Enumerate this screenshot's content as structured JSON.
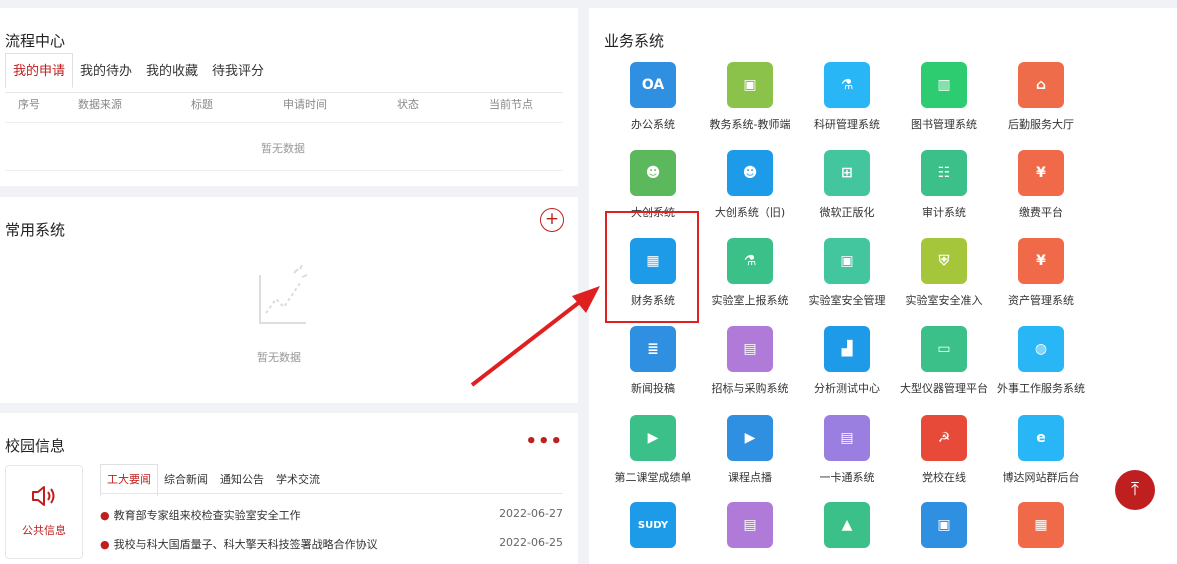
{
  "flow": {
    "title": "流程中心",
    "tabs": [
      "我的申请",
      "我的待办",
      "我的收藏",
      "待我评分"
    ],
    "columns": [
      "序号",
      "数据来源",
      "标题",
      "申请时间",
      "状态",
      "当前节点"
    ],
    "empty_text": "暂无数据"
  },
  "common": {
    "title": "常用系统",
    "add_label": "+",
    "empty_text": "暂无数据"
  },
  "campus": {
    "title": "校园信息",
    "more_label": "•••",
    "notice_label": "公共信息",
    "news_tabs": [
      "工大要闻",
      "综合新闻",
      "通知公告",
      "学术交流"
    ],
    "news": [
      {
        "title": "教育部专家组来校检查实验室安全工作",
        "date": "2022-06-27"
      },
      {
        "title": "我校与科大国盾量子、科大擎天科技签署战略合作协议",
        "date": "2022-06-25"
      }
    ]
  },
  "biz": {
    "title": "业务系统",
    "items": [
      {
        "label": "办公系统",
        "icon": "oa-icon",
        "color": "#2f8fe0",
        "glyph": "OA"
      },
      {
        "label": "教务系统-教师端",
        "icon": "teacher-screen-icon",
        "color": "#8bc34a",
        "glyph": "▣"
      },
      {
        "label": "科研管理系统",
        "icon": "microscope-icon",
        "color": "#29b6f6",
        "glyph": "⚗"
      },
      {
        "label": "图书管理系统",
        "icon": "books-icon",
        "color": "#2ecc71",
        "glyph": "▥"
      },
      {
        "label": "后勤服务大厅",
        "icon": "house-user-icon",
        "color": "#ef6c4a",
        "glyph": "⌂"
      },
      {
        "label": "大创系统",
        "icon": "graduates-icon",
        "color": "#5cb85c",
        "glyph": "☻"
      },
      {
        "label": "大创系统（旧)",
        "icon": "graduates-old-icon",
        "color": "#1e9be8",
        "glyph": "☻"
      },
      {
        "label": "微软正版化",
        "icon": "windows-icon",
        "color": "#43c59e",
        "glyph": "⊞"
      },
      {
        "label": "审计系统",
        "icon": "clipboard-icon",
        "color": "#3cc08a",
        "glyph": "☷"
      },
      {
        "label": "缴费平台",
        "icon": "payment-icon",
        "color": "#f06a4a",
        "glyph": "¥"
      },
      {
        "label": "财务系统",
        "icon": "finance-monitor-icon",
        "color": "#1e9be8",
        "glyph": "▦"
      },
      {
        "label": "实验室上报系统",
        "icon": "lab-report-icon",
        "color": "#3cc08a",
        "glyph": "⚗"
      },
      {
        "label": "实验室安全管理",
        "icon": "lab-safety-monitor-icon",
        "color": "#43c59e",
        "glyph": "▣"
      },
      {
        "label": "实验室安全准入",
        "icon": "shield-icon",
        "color": "#a5c63b",
        "glyph": "⛨"
      },
      {
        "label": "资产管理系统",
        "icon": "asset-house-icon",
        "color": "#f06a4a",
        "glyph": "¥"
      },
      {
        "label": "新闻投稿",
        "icon": "news-icon",
        "color": "#2f8fe0",
        "glyph": "≣"
      },
      {
        "label": "招标与采购系统",
        "icon": "cart-icon",
        "color": "#b07ad8",
        "glyph": "▤"
      },
      {
        "label": "分析测试中心",
        "icon": "bar-chart-icon",
        "color": "#1e9be8",
        "glyph": "▟"
      },
      {
        "label": "大型仪器管理平台",
        "icon": "instrument-monitor-icon",
        "color": "#3cc08a",
        "glyph": "▭"
      },
      {
        "label": "外事工作服务系统",
        "icon": "globe-monitor-icon",
        "color": "#29b6f6",
        "glyph": "◍"
      },
      {
        "label": "第二课堂成绩单",
        "icon": "play-hexagon-icon",
        "color": "#3cc08a",
        "glyph": "▶"
      },
      {
        "label": "课程点播",
        "icon": "video-icon",
        "color": "#2f8fe0",
        "glyph": "▶"
      },
      {
        "label": "一卡通系统",
        "icon": "id-card-icon",
        "color": "#9b7fe0",
        "glyph": "▤"
      },
      {
        "label": "党校在线",
        "icon": "party-emblem-icon",
        "color": "#e84a3a",
        "glyph": "☭"
      },
      {
        "label": "博达网站群后台",
        "icon": "ie-monitor-icon",
        "color": "#29b6f6",
        "glyph": "e"
      },
      {
        "label": "",
        "icon": "sudy-icon",
        "color": "#1e9be8",
        "glyph": "SUDY"
      },
      {
        "label": "",
        "icon": "seal-document-icon",
        "color": "#b07ad8",
        "glyph": "▤"
      },
      {
        "label": "",
        "icon": "graduation-cap-icon",
        "color": "#3cc08a",
        "glyph": "▲"
      },
      {
        "label": "",
        "icon": "picture-document-icon",
        "color": "#2f8fe0",
        "glyph": "▣"
      },
      {
        "label": "",
        "icon": "calendar-icon",
        "color": "#f06a4a",
        "glyph": "▦"
      }
    ]
  },
  "up_label": "⤒"
}
